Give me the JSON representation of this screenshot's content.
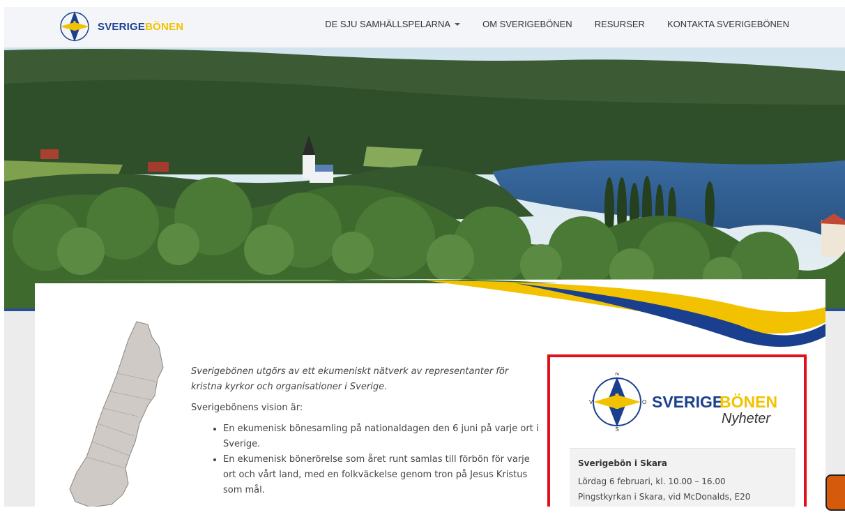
{
  "header": {
    "logo": {
      "part1": "SVERIGE",
      "part2": "BÖNEN"
    },
    "nav": [
      {
        "label": "DE SJU SAMHÄLLSPELARNA",
        "dropdown": true
      },
      {
        "label": "OM SVERIGEBÖNEN"
      },
      {
        "label": "RESURSER"
      },
      {
        "label": "KONTAKTA SVERIGEBÖNEN"
      }
    ]
  },
  "colors": {
    "brand_blue": "#1b3f8f",
    "brand_yellow": "#f2c200",
    "highlight_red": "#e0101a"
  },
  "intro": {
    "lead": "Sverigebönen utgörs av ett ekumeniskt nätverk av representanter för kristna kyrkor och organisationer i Sverige.",
    "vision_heading": "Sverigebönens vision är:",
    "bullets": [
      "En ekumenisk bönesamling på nationaldagen den 6 juni på varje ort i Sverige.",
      "En ekumenisk bönerörelse som året runt samlas till förbön för varje ort och vårt land, med en folkväckelse genom tron på Jesus Kristus som mål."
    ]
  },
  "news": {
    "logo": {
      "part1": "SVERIGE",
      "part2": "BÖNEN",
      "subtitle": "Nyheter",
      "n": "N",
      "s": "S",
      "v": "V",
      "o": "O"
    },
    "item": {
      "title": "Sverigebön i Skara",
      "line1": "Lördag 6 februari, kl. 10.00 – 16.00",
      "line2": "Pingstkyrkan i Skara, vid McDonalds, E20"
    }
  }
}
